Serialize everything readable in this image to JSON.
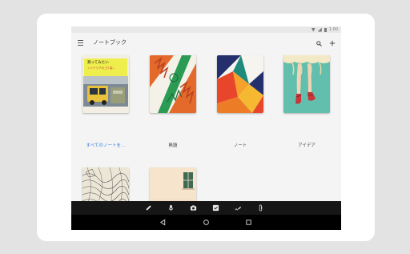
{
  "statusbar": {
    "time": "1:00"
  },
  "appbar": {
    "title": "ノートブック"
  },
  "notebooks": [
    {
      "label": "すべてのノートを…",
      "sticky_title": "買ってみたい",
      "sticky_text": "インテリアのゴミ袋…"
    },
    {
      "label": "無題"
    },
    {
      "label": "ノート"
    },
    {
      "label": "アイデア"
    },
    {
      "label": ""
    },
    {
      "label": ""
    }
  ],
  "toolbar": {
    "items": [
      "pen-icon",
      "mic-icon",
      "camera-icon",
      "checkbox-icon",
      "handwriting-icon",
      "attachment-icon"
    ]
  },
  "navigation": [
    "back-icon",
    "home-icon",
    "recents-icon"
  ],
  "colors": {
    "accent": "#2f7de1",
    "toolbar_bg": "#161616",
    "navbar_bg": "#000000",
    "screen_bg": "#f4f4f4"
  }
}
